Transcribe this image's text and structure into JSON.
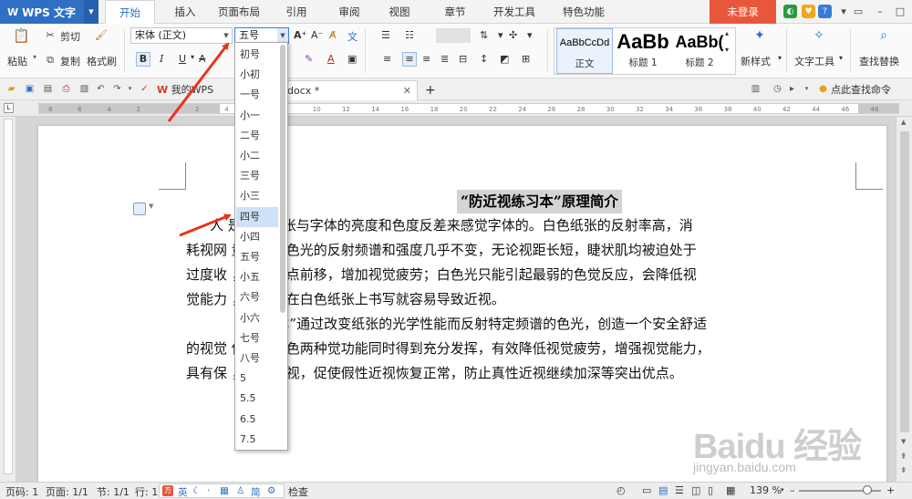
{
  "app": {
    "name": "WPS 文字"
  },
  "menu": {
    "tabs": [
      "开始",
      "插入",
      "页面布局",
      "引用",
      "审阅",
      "视图",
      "章节",
      "开发工具",
      "特色功能"
    ],
    "active_tab": "开始",
    "login_label": "未登录"
  },
  "ribbon": {
    "cut_label": "剪切",
    "copy_label": "复制",
    "format_painter_label": "格式刷",
    "paste_label": "粘贴",
    "font_name": "宋体 (正文)",
    "font_size": "五号",
    "styles": [
      {
        "sample": "AaBbCcDd",
        "label": "正文"
      },
      {
        "sample": "AaBb",
        "label": "标题 1"
      },
      {
        "sample": "AaBb(",
        "label": "标题 2"
      }
    ],
    "new_style_label": "新样式",
    "text_tools_label": "文字工具",
    "find_replace_label": "查找替换",
    "bold_label": "B",
    "italic_label": "I",
    "underline_label": "U"
  },
  "quickbar": {
    "my_wps_label": "我的WPS",
    "doc_tab_label": "docx *",
    "new_tab_label": "+",
    "search_hint": "点此查找命令 (Alt-"
  },
  "ruler": {
    "numbers": [
      "8",
      "6",
      "4",
      "2",
      "",
      "2",
      "4",
      "6",
      "8",
      "10",
      "12",
      "14",
      "16",
      "18",
      "20",
      "22",
      "24",
      "26",
      "28",
      "30",
      "32",
      "34",
      "36",
      "38",
      "40",
      "42",
      "44",
      "46",
      "48"
    ]
  },
  "font_size_dropdown": {
    "items": [
      "初号",
      "小初",
      "一号",
      "小一",
      "二号",
      "小二",
      "三号",
      "小三",
      "四号",
      "小四",
      "五号",
      "小五",
      "六号",
      "小六",
      "七号",
      "八号",
      "5",
      "5.5",
      "6.5",
      "7.5"
    ],
    "highlighted": "四号"
  },
  "document": {
    "title": "“防近视练习本”原理简介",
    "lines": [
      "人   是通过纸张与字体的亮度和色度反差来感觉字体的。白色纸张的反射率高，消",
      "耗视网   量大；白色光的反射频谱和强度几乎不变，无论视距长短，睫状肌均被迫处于",
      "过度收   ，使视焦点前移，增加视觉疲劳；白色光只能引起最弱的色觉反应，会降低视",
      "觉能力   ，长时期在白色纸张上书写就容易导致近视。",
      "“   练习本”通过改变纸张的光学性能而反射特定频谱的色光，创造一个安全舒适",
      "的视觉   使感光感色两种觉功能同时得到充分发挥，有效降低视觉疲劳，增强视觉能力，",
      "具有保   ，预防近视，促使假性近视恢复正常，防止真性近视继续加深等突出优点。"
    ]
  },
  "statusbar": {
    "page_code": "页码: 1",
    "pages": "页面: 1/1",
    "section": "节: 1/1",
    "line": "行: 1",
    "ime_items": [
      "英",
      "简"
    ],
    "check_label": "检查",
    "zoom": "139 %"
  },
  "watermark": {
    "logo": "Baidu 经验",
    "url": "jingyan.baidu.com"
  },
  "colors": {
    "accent": "#2f6fc4",
    "login": "#e8573b",
    "arrow": "#e8341c",
    "highlight": "#cfe1f7"
  }
}
